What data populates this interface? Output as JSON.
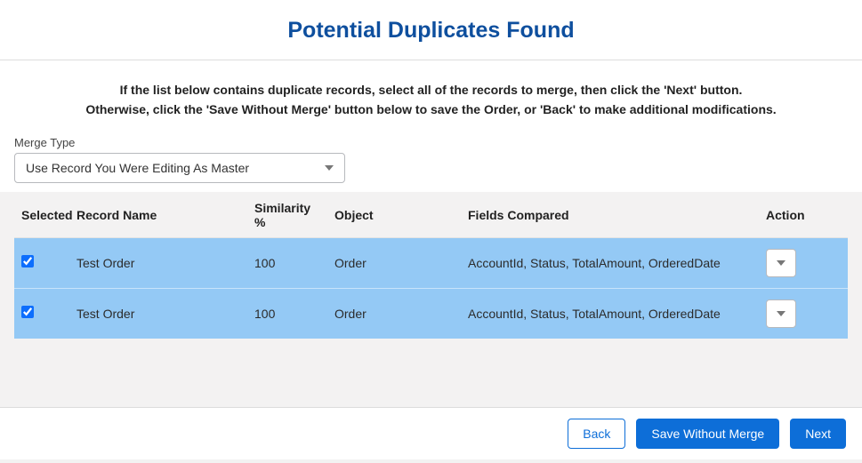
{
  "title": "Potential Duplicates Found",
  "instructions": {
    "line1": "If the list below contains duplicate records, select all of the records to merge, then click the 'Next' button.",
    "line2": "Otherwise, click the 'Save Without Merge' button below to save the Order, or 'Back' to make additional modifications."
  },
  "merge_type": {
    "label": "Merge Type",
    "selected": "Use Record You Were Editing As Master"
  },
  "table": {
    "headers": {
      "selected": "Selected",
      "record_name": "Record Name",
      "similarity": "Similarity %",
      "object": "Object",
      "fields_compared": "Fields Compared",
      "action": "Action"
    },
    "rows": [
      {
        "selected": true,
        "record_name": "Test Order",
        "similarity": "100",
        "object": "Order",
        "fields_compared": "AccountId, Status, TotalAmount, OrderedDate"
      },
      {
        "selected": true,
        "record_name": "Test Order",
        "similarity": "100",
        "object": "Order",
        "fields_compared": "AccountId, Status, TotalAmount, OrderedDate"
      }
    ]
  },
  "footer": {
    "back": "Back",
    "save_without_merge": "Save Without Merge",
    "next": "Next"
  }
}
